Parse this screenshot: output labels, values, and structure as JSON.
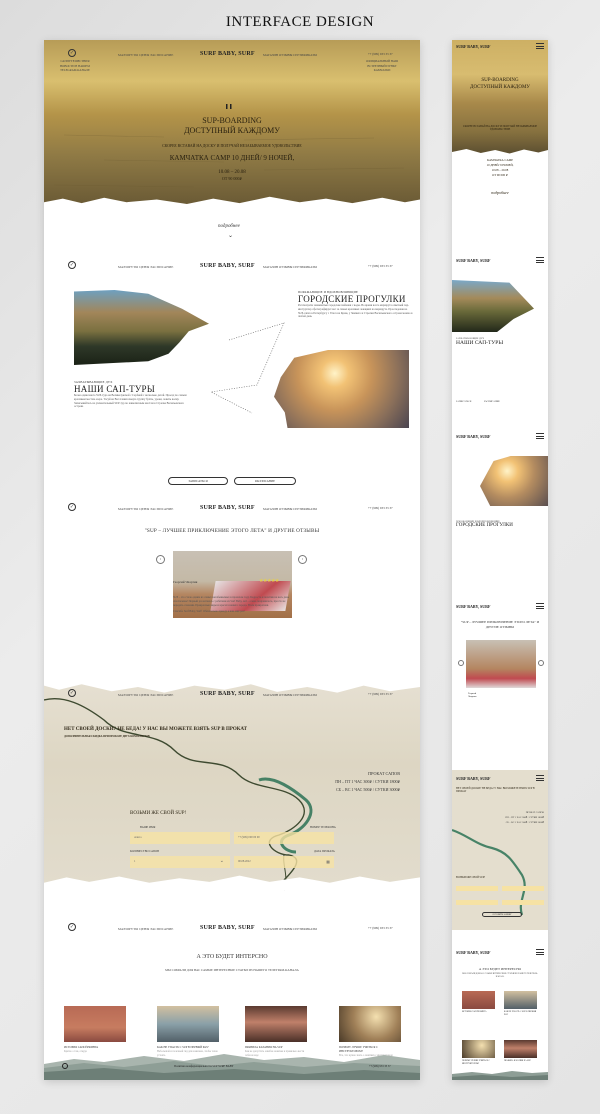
{
  "page_title": "INTERFACE DESIGN",
  "nav": {
    "brand": "SURF BABY, SURF",
    "links_left": "МАРШРУТЫ  ЦЕНЫ  РАСПИСАНИЕ",
    "links_right": "МАГАЗИН  ОТЗЫВЫ  СЕРТИФИКАТЫ",
    "phone": "+7 (999) 933 33 37",
    "left_sub": [
      "САППУТЕШЕСТВИЯ",
      "НОВОСТИ В НАШЕМ",
      "TELEGRAM-КАНАЛЕ"
    ],
    "right_sub": [
      "ОФИЦИАЛЬНЫЙ НАШ",
      "ВСТРЕЧНЫЙ ПУНКТ",
      "КАМЧАТКИ"
    ]
  },
  "hero": {
    "title_line1": "SUP-BOARDING",
    "title_line2": "ДОСТУПНЫЙ КАЖДОМУ",
    "subtitle": "СКОРЕЕ ВСТАВАЙ НА ДОСКУ И ПОЛУЧАЙ НЕЗАБЫВАЕМОЕ УДОВОЛЬСТВИЕ",
    "camp": "КАМЧАТКА CAMP 10 ДНЕЙ/ 9 НОЧЕЙ,",
    "dates": "10.08 – 20.08",
    "price": "ОТ 90 000₽",
    "more_link": "подробнее"
  },
  "walks": {
    "kicker": "ПОРАЖАЮЩИЕ И ВДОХНОВЛЯЮЩИЕ",
    "heading": "ГОРОДСКИЕ ПРОГУЛКИ",
    "body": "Рассмотрите знаменитые городские пейзажи с воды. Во время всего маршрута опытный гид-инструктор сфотографирует вас за самых красивых локациях на маршруте. Проследовав на SUP-сапах к Петербургу с Уласа на Крюк, у Зимнего и Стрелки Васильевского острова можно в любой день"
  },
  "tours": {
    "kicker": "ЗАХВАТЫВАЮЩИЕ ДУХ",
    "heading": "НАШИ САП-ТУРЫ",
    "body": "Более одиночного SUP-тура на Великолукской с Сербией с несколько детей. Проезд по самым красивым местам озера. Тасуй на Вас плавательную группу бухты, уроки, ловить волну. Записывайтесь на увлекательный SUP-тур по живописным местам к Стрелке Васильевского острова"
  },
  "buttons": {
    "signup": "ЗАПИСАТЬСЯ",
    "schedule": "РАСПИСАНИЕ",
    "submit": "ОСТАВИТЬ ЗАЯВКУ"
  },
  "reviews": {
    "heading": "\"SUP – ЛУЧШЕЕ ПРИКЛЮЧЕНИЕ ЭТОГО ЛЕТА\" И ДРУГИЕ ОТЗЫВЫ",
    "reviewer": "Георгий Чхартия",
    "rating": 5,
    "stars": "★★★★★",
    "text1": "SUP – это стало одним из самых незабываемых в прошлом году. Бодрость и позитив на весь день обеспечены! Первый раз катаюсь с ребятами из Surf Baby, всё – очень понравилось, просто не передать словами. Прекрасные виды и красота нашего города. Всем прекрасная.",
    "text2": "Спасибо Surf Baby, Surf! Обязательно приеду к вам ещё раз!",
    "prev_icon": "‹",
    "next_icon": "›"
  },
  "rental": {
    "heading": "НЕТ СВОЕЙ ДОСКИ? НЕ БЕДА! У НАС ВЫ МОЖЕТЕ ВЗЯТЬ SUP В ПРОКАТ",
    "subheading": "ДОПОЛНИТЕЛЬНАЯ СКИДКА ПРИ ПРОКАТЕ ДВУХ КОМПЛЕКТОВ",
    "prices_title": "ПРОКАТ САПОВ",
    "price_weekday": "ПН – ПТ  1 ЧАС 300₽ / СУТКИ 1800₽",
    "price_weekend": "СБ – ВС 1 ЧАС 500₽ / СУТКИ 3000₽",
    "form_title": "ВОЗЬМИ ЖЕ СВОЙ SUP!",
    "name_label": "ВАШЕ ИМЯ",
    "name_value": "Алиса",
    "phone_label": "НОМЕР ТЕЛЕФОНА",
    "phone_value": "+7 (999) 000 00 00",
    "qty_label": "КОЛИЧЕСТВО САПОВ",
    "qty_value": "1",
    "date_label": "ДАТА ПРОКАТА",
    "date_value": "00.08.2022"
  },
  "interesting": {
    "heading": "А ЭТО БУДЕТ ИНТЕРСНО",
    "subheading": "МЫ СОБРАЛИ ДЛЯ ВАС САМЫЕ ИНТЕРЕСНЫЕ СТАТЬИ ИЗ НАШЕГО ТЕЛЕГРАМ-КАНАЛА",
    "articles": [
      {
        "title": "ИСТОРИЯ САПСЁРФИНГА",
        "meta": "Кратко о том, откуда"
      },
      {
        "title": "КАК НЕ УПАСТЬ С SUP В ПЕРВЫЙ РАЗ?",
        "meta": "Небольшой и полезный гид для новичков, чтобы точно устоять"
      },
      {
        "title": "ПРАВИЛА КАТАНИЯ НА SUP",
        "meta": "Как не допустить ошибок новичка и правильно вести себя на воде"
      },
      {
        "title": "ПОЧЕМУ ЛУЧШЕ УЧИТЬСЯ С ИНСТРУКТОРОМ?",
        "meta": "Все, что нужно знать о занятиях с инструктором"
      }
    ]
  },
  "footer": {
    "text": "Политика конфиденциальности  SUP SURF BABY",
    "phone": "+7 (999) 933 33 37"
  },
  "mobile": {
    "brand": "SURF BABY, SURF",
    "hero_title1": "SUP-BOARDING",
    "hero_title2": "ДОСТУПНЫЙ КАЖДОМУ",
    "hero_sub": "СКОРЕЕ ВСТАВАЙ НА ДОСКУ И ПОЛУЧАЙ НЕЗАБЫВАЕМОЕ УДОВОЛЬСТВИЕ",
    "camp1": "КАМЧАТКА CAMP",
    "camp2": "10 ДНЕЙ/ 9 НОЧЕЙ,",
    "dates": "10.08 – 20.08",
    "price": "ОТ 90 000 ₽",
    "more_link": "подробнее",
    "tours_kicker": "ЗАХВАТЫВАЮЩИЕ ДУХ",
    "tours_heading": "НАШИ САП-ТУРЫ",
    "walks_kicker": "ПОРАЖАЮЩИЕ И ВДОХНОВЛЯЮЩИЕ",
    "walks_heading": "ГОРОДСКИЕ ПРОГУЛКИ",
    "signup": "ЗАПИСАТЬСЯ",
    "schedule": "РАСПИСАНИЕ",
    "reviews_heading": "\"SUP – ЛУЧШЕЕ ПРИКЛЮЧЕНИЕ ЭТОГО ЛЕТА\" И ДРУГИЕ ОТЗЫВЫ",
    "reviewer1": "Георгий",
    "reviewer2": "Чхартия",
    "rental_heading": "НЕТ СВОЕЙ ДОСКИ? НЕ БЕДА! У НАС ВЫ МОЖЕТЕ ВЗЯТЬ SUP В ПРОКАТ",
    "prices_title": "ПРОКАТ САПОВ",
    "price_weekday": "ПН – ПТ 1 ЧАС 300₽ / СУТКИ 1800₽",
    "price_weekend": "СБ – ВС 1 ЧАС 500₽ / СУТКИ 3000₽",
    "form_title": "ВОЗЬМИ ЖЕ СВОЙ SUP!",
    "submit": "ОСТАВИТЬ ЗАЯВКУ",
    "interesting_heading": "А ЭТО БУДЕТ ИНТЕРЕСНО",
    "interesting_sub": "МЫ СОБРАЛИ ДЛЯ ВАС САМЫЕ ИНТЕРЕСНЫЕ СТАТЬИ ИЗ НАШЕГО ТЕЛЕГРАМ-КАНАЛА",
    "articles": [
      "ИСТОРИЯ САПСЁРФИНГА",
      "КАК НЕ УПАСТЬ С SUP В ПЕРВЫЙ РАЗ?",
      "ПОЧЕМУ ЛУЧШЕ УЧИТЬСЯ С ИНСТРУКТОРОМ?",
      "ПРАВИЛА КАТАНИЯ НА SUP"
    ]
  },
  "colors": {
    "hero_gold": "#d9bf6f",
    "form_field": "#f6e2a4",
    "star": "#e5cf4a",
    "river": "#1f6b4e",
    "mountains": "#7d8f86"
  }
}
